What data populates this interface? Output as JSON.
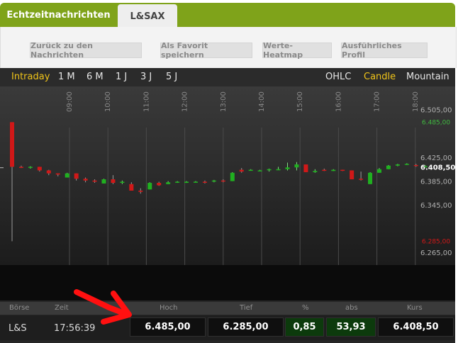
{
  "tabs": [
    {
      "label": "Echtzeitnachrichten",
      "active": false
    },
    {
      "label": "L&SAX",
      "active": true
    }
  ],
  "toolbar": {
    "buttons": [
      "Zurück zu den Nachrichten",
      "Als Favorit speichern",
      "Werte-Heatmap",
      "Ausführliches Profil"
    ]
  },
  "periods": {
    "left": [
      "Intraday",
      "1 M",
      "6 M",
      "1 J",
      "3 J",
      "5 J"
    ],
    "active": "Intraday",
    "right": [
      "OHLC",
      "Candle",
      "Mountain"
    ],
    "active_type": "Candle"
  },
  "colors": {
    "accent": "#7fa31a",
    "active": "#f0c419",
    "up": "#20b020",
    "down": "#d01818"
  },
  "chart_data": {
    "type": "candlestick",
    "x_ticks": [
      "09:00",
      "10:00",
      "11:00",
      "12:00",
      "13:00",
      "14:00",
      "15:00",
      "16:00",
      "17:00",
      "18:00"
    ],
    "y_ticks": [
      "6.505,00",
      "6.425,00",
      "6.385,00",
      "6.345,00",
      "6.265,00"
    ],
    "hoch_label": "6.485,00",
    "tief_label": "6.285,00",
    "last_label": "6.408,50",
    "ylim": [
      6245,
      6545
    ],
    "candles": [
      [
        6485,
        6485,
        6285,
        6410
      ],
      [
        6410,
        6412,
        6408,
        6409
      ],
      [
        6409,
        6411,
        6407,
        6410
      ],
      [
        6410,
        6410,
        6402,
        6404
      ],
      [
        6404,
        6405,
        6396,
        6399
      ],
      [
        6399,
        6399,
        6394,
        6397
      ],
      [
        6392,
        6400,
        6392,
        6399
      ],
      [
        6399,
        6399,
        6387,
        6390
      ],
      [
        6390,
        6392,
        6384,
        6387
      ],
      [
        6387,
        6389,
        6383,
        6385
      ],
      [
        6382,
        6390,
        6382,
        6389
      ],
      [
        6389,
        6396,
        6381,
        6383
      ],
      [
        6383,
        6387,
        6381,
        6385
      ],
      [
        6381,
        6384,
        6370,
        6370
      ],
      [
        6370,
        6374,
        6365,
        6368
      ],
      [
        6372,
        6384,
        6372,
        6383
      ],
      [
        6383,
        6385,
        6378,
        6379
      ],
      [
        6381,
        6386,
        6381,
        6384
      ],
      [
        6384,
        6386,
        6383,
        6385
      ],
      [
        6383,
        6386,
        6383,
        6385
      ],
      [
        6384,
        6386,
        6384,
        6385
      ],
      [
        6385,
        6387,
        6382,
        6384
      ],
      [
        6386,
        6388,
        6384,
        6387
      ],
      [
        6387,
        6389,
        6384,
        6386
      ],
      [
        6386,
        6401,
        6386,
        6400
      ],
      [
        6405,
        6408,
        6400,
        6402
      ],
      [
        6404,
        6406,
        6404,
        6405
      ],
      [
        6404,
        6405,
        6403,
        6404
      ],
      [
        6405,
        6407,
        6402,
        6406
      ],
      [
        6406,
        6410,
        6405,
        6406
      ],
      [
        6406,
        6417,
        6404,
        6409
      ],
      [
        6409,
        6418,
        6404,
        6414
      ],
      [
        6414,
        6414,
        6401,
        6401
      ],
      [
        6401,
        6406,
        6400,
        6403
      ],
      [
        6405,
        6407,
        6403,
        6404
      ],
      [
        6403,
        6406,
        6403,
        6405
      ],
      [
        6405,
        6405,
        6403,
        6404
      ],
      [
        6404,
        6404,
        6389,
        6389
      ],
      [
        6390,
        6402,
        6387,
        6389
      ],
      [
        6381,
        6401,
        6381,
        6400
      ],
      [
        6400,
        6408,
        6400,
        6406
      ],
      [
        6406,
        6413,
        6406,
        6412
      ],
      [
        6412,
        6415,
        6411,
        6414
      ],
      [
        6414,
        6416,
        6413,
        6415
      ],
      [
        6413,
        6415,
        6410,
        6412
      ],
      [
        6410,
        6413,
        6409,
        6411
      ]
    ]
  },
  "table": {
    "headers": [
      "Börse",
      "Zeit",
      "Hoch",
      "Tief",
      "%",
      "abs",
      "Kurs"
    ],
    "row": {
      "exchange": "L&S",
      "time": "17:56:39",
      "hoch": "6.485,00",
      "tief": "6.285,00",
      "pct": "0,85",
      "abs": "53,93",
      "kurs": "6.408,50"
    }
  }
}
